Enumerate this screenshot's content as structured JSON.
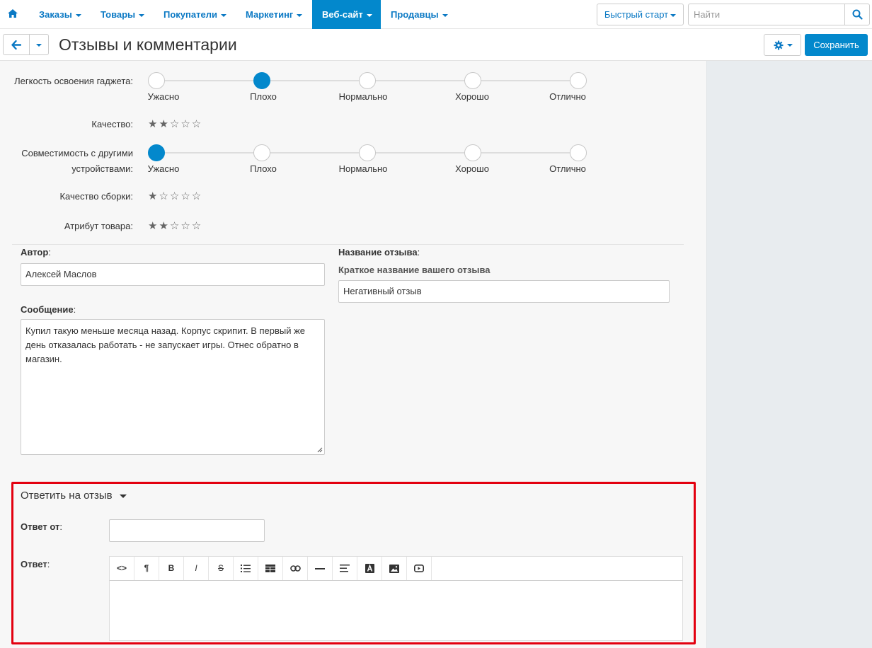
{
  "nav": {
    "items": [
      {
        "label": "Заказы"
      },
      {
        "label": "Товары"
      },
      {
        "label": "Покупатели"
      },
      {
        "label": "Маркетинг"
      },
      {
        "label": "Веб-сайт"
      },
      {
        "label": "Продавцы"
      }
    ],
    "active_item": "Веб-сайт",
    "quick_start_label": "Быстрый старт",
    "search_placeholder": "Найти"
  },
  "header": {
    "title": "Отзывы и комментарии",
    "save_label": "Сохранить"
  },
  "attributes": [
    {
      "label": "Легкость освоения гаджета:",
      "type": "scale",
      "options": [
        "Ужасно",
        "Плохо",
        "Нормально",
        "Хорошо",
        "Отлично"
      ],
      "selected": "Плохо"
    },
    {
      "label": "Качество:",
      "type": "stars",
      "value": 2,
      "max": 5
    },
    {
      "label": "Совместимость с другими устройствами:",
      "type": "scale",
      "options": [
        "Ужасно",
        "Плохо",
        "Нормально",
        "Хорошо",
        "Отлично"
      ],
      "selected": "Ужасно"
    },
    {
      "label": "Качество сборки:",
      "type": "stars",
      "value": 1,
      "max": 5
    },
    {
      "label": "Атрибут товара:",
      "type": "stars",
      "value": 2,
      "max": 5
    }
  ],
  "form": {
    "author_label": "Автор",
    "author_value": "Алексей Маслов",
    "message_label": "Сообщение",
    "message_value": "Купил такую меньше месяца назад. Корпус скрипит. В первый же день отказалась работать - не запускает игры. Отнес обратно в магазин.",
    "review_title_label": "Название отзыва",
    "review_title_hint": "Краткое название вашего отзыва",
    "review_title_value": "Негативный отзыв",
    "colon": ":"
  },
  "reply": {
    "section_title": "Ответить на отзыв",
    "from_label": "Ответ от",
    "from_value": "",
    "reply_label": "Ответ",
    "toolbar": [
      {
        "icon": "code-view-icon",
        "glyph": "<>"
      },
      {
        "icon": "paragraph-icon",
        "glyph": "¶"
      },
      {
        "icon": "bold-icon",
        "glyph": "B"
      },
      {
        "icon": "italic-icon",
        "glyph": "I"
      },
      {
        "icon": "strikethrough-icon",
        "glyph": "S"
      },
      {
        "icon": "list-icon",
        "glyph": "≡"
      },
      {
        "icon": "table-icon",
        "glyph": "▦"
      },
      {
        "icon": "link-icon",
        "glyph": "⚭"
      },
      {
        "icon": "horizontal-rule-icon",
        "glyph": "—"
      },
      {
        "icon": "align-icon",
        "glyph": "≡"
      },
      {
        "icon": "font-color-icon",
        "glyph": "A"
      },
      {
        "icon": "image-icon",
        "glyph": "▣"
      },
      {
        "icon": "video-icon",
        "glyph": "▶"
      }
    ]
  },
  "colors": {
    "accent": "#0388cc",
    "link": "#0b79c4",
    "highlight_border": "#e3000f"
  }
}
